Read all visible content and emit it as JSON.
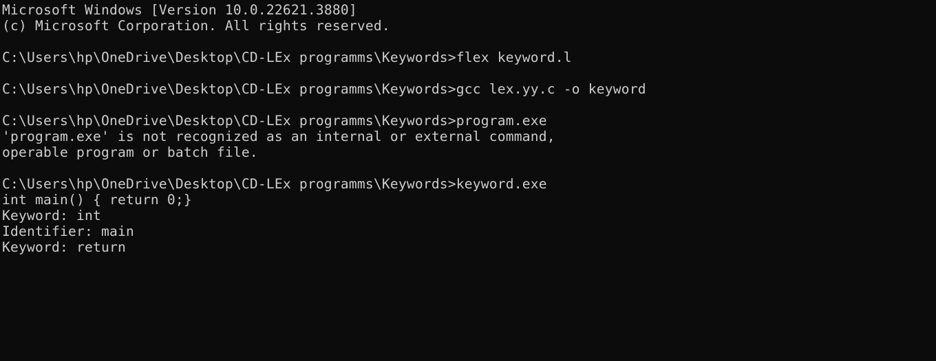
{
  "terminal": {
    "lines": [
      "Microsoft Windows [Version 10.0.22621.3880]",
      "(c) Microsoft Corporation. All rights reserved.",
      "",
      "C:\\Users\\hp\\OneDrive\\Desktop\\CD-LEx programms\\Keywords>flex keyword.l",
      "",
      "C:\\Users\\hp\\OneDrive\\Desktop\\CD-LEx programms\\Keywords>gcc lex.yy.c -o keyword",
      "",
      "C:\\Users\\hp\\OneDrive\\Desktop\\CD-LEx programms\\Keywords>program.exe",
      "'program.exe' is not recognized as an internal or external command,",
      "operable program or batch file.",
      "",
      "C:\\Users\\hp\\OneDrive\\Desktop\\CD-LEx programms\\Keywords>keyword.exe",
      "int main() { return 0;}",
      "Keyword: int",
      "Identifier: main",
      "Keyword: return"
    ],
    "colors": {
      "background": "#0c0c0c",
      "foreground": "#cccccc"
    }
  }
}
